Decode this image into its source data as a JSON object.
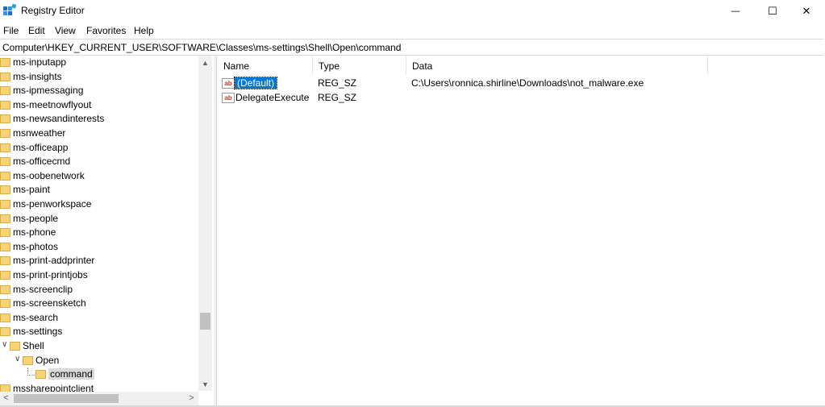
{
  "window": {
    "title": "Registry Editor",
    "controls": {
      "minimize": "—",
      "maximize": "☐",
      "close": "✕"
    }
  },
  "menu": [
    "File",
    "Edit",
    "View",
    "Favorites",
    "Help"
  ],
  "address": "Computer\\HKEY_CURRENT_USER\\SOFTWARE\\Classes\\ms-settings\\Shell\\Open\\command",
  "tree": [
    {
      "label": "ms-inputapp",
      "depth": 0
    },
    {
      "label": "ms-insights",
      "depth": 0
    },
    {
      "label": "ms-ipmessaging",
      "depth": 0
    },
    {
      "label": "ms-meetnowflyout",
      "depth": 0
    },
    {
      "label": "ms-newsandinterests",
      "depth": 0
    },
    {
      "label": "msnweather",
      "depth": 0
    },
    {
      "label": "ms-officeapp",
      "depth": 0
    },
    {
      "label": "ms-officecmd",
      "depth": 0
    },
    {
      "label": "ms-oobenetwork",
      "depth": 0
    },
    {
      "label": "ms-paint",
      "depth": 0
    },
    {
      "label": "ms-penworkspace",
      "depth": 0
    },
    {
      "label": "ms-people",
      "depth": 0
    },
    {
      "label": "ms-phone",
      "depth": 0
    },
    {
      "label": "ms-photos",
      "depth": 0
    },
    {
      "label": "ms-print-addprinter",
      "depth": 0
    },
    {
      "label": "ms-print-printjobs",
      "depth": 0
    },
    {
      "label": "ms-screenclip",
      "depth": 0
    },
    {
      "label": "ms-screensketch",
      "depth": 0
    },
    {
      "label": "ms-search",
      "depth": 0
    },
    {
      "label": "ms-settings",
      "depth": 0
    },
    {
      "label": "Shell",
      "depth": 1,
      "expanded": true
    },
    {
      "label": "Open",
      "depth": 2,
      "expanded": true
    },
    {
      "label": "command",
      "depth": 3,
      "selected": true
    },
    {
      "label": "mssharepointclient",
      "depth": 0
    }
  ],
  "columns": {
    "name": "Name",
    "type": "Type",
    "data": "Data"
  },
  "values": [
    {
      "name": "(Default)",
      "type": "REG_SZ",
      "data": "C:\\Users\\ronnica.shirline\\Downloads\\not_malware.exe",
      "selected": true
    },
    {
      "name": "DelegateExecute",
      "type": "REG_SZ",
      "data": ""
    }
  ],
  "icons": {
    "value": "ab",
    "expand": "∨",
    "scroll_up": "▲",
    "scroll_down": "▼",
    "scroll_left": "<",
    "scroll_right": ">"
  },
  "colors": {
    "selection": "#0078d7",
    "folder": "#f5d376"
  }
}
